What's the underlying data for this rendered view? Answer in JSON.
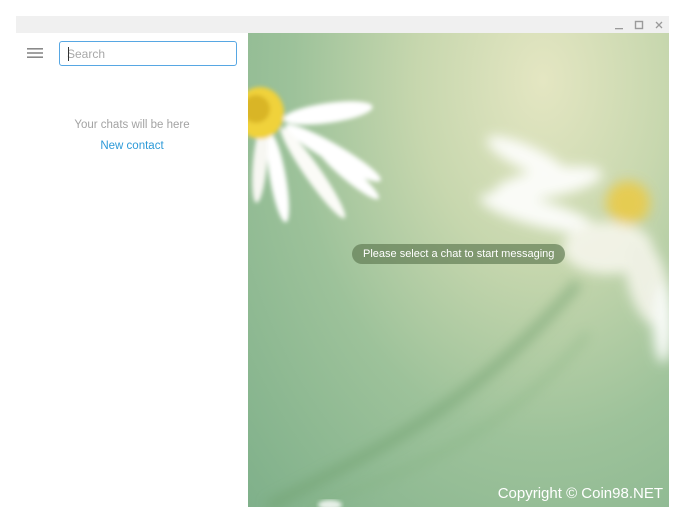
{
  "window": {
    "controls": {
      "minimize": "minimize-icon",
      "maximize": "maximize-icon",
      "close": "close-icon"
    }
  },
  "sidebar": {
    "menu_icon": "hamburger-menu-icon",
    "search": {
      "placeholder": "Search",
      "value": ""
    },
    "empty_message": "Your chats will be here",
    "new_contact_label": "New contact"
  },
  "chat": {
    "placeholder": "Please select a chat to start messaging",
    "watermark": "Copyright © Coin98.NET"
  },
  "colors": {
    "accent": "#57a7e3",
    "link": "#2d9ad8",
    "muted_text": "#a3a3a3",
    "pill_bg": "#607a52"
  }
}
